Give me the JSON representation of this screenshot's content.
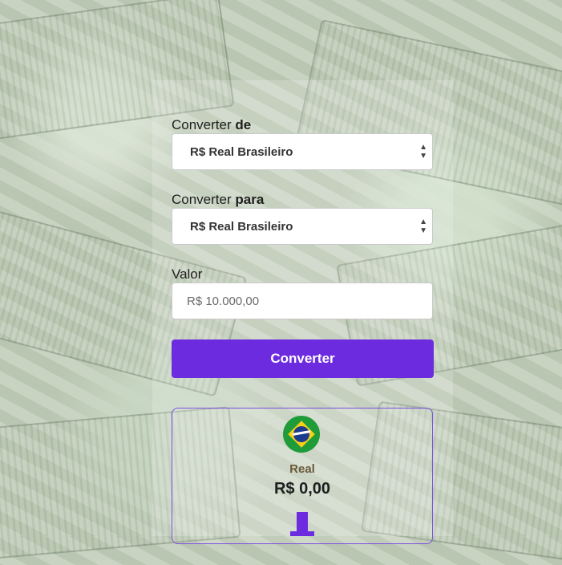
{
  "from": {
    "label_prefix": "Converter",
    "label_bold": "de",
    "selected": "R$ Real Brasileiro"
  },
  "to": {
    "label_prefix": "Converter",
    "label_bold": "para",
    "selected": "R$ Real Brasileiro"
  },
  "amount": {
    "label": "Valor",
    "placeholder": "R$ 10.000,00"
  },
  "convert_button": "Converter",
  "result": {
    "currency_name": "Real",
    "value": "R$ 0,00",
    "flag": "brazil-flag-icon"
  },
  "colors": {
    "accent": "#6d2be0",
    "border": "#7b4fe0"
  }
}
